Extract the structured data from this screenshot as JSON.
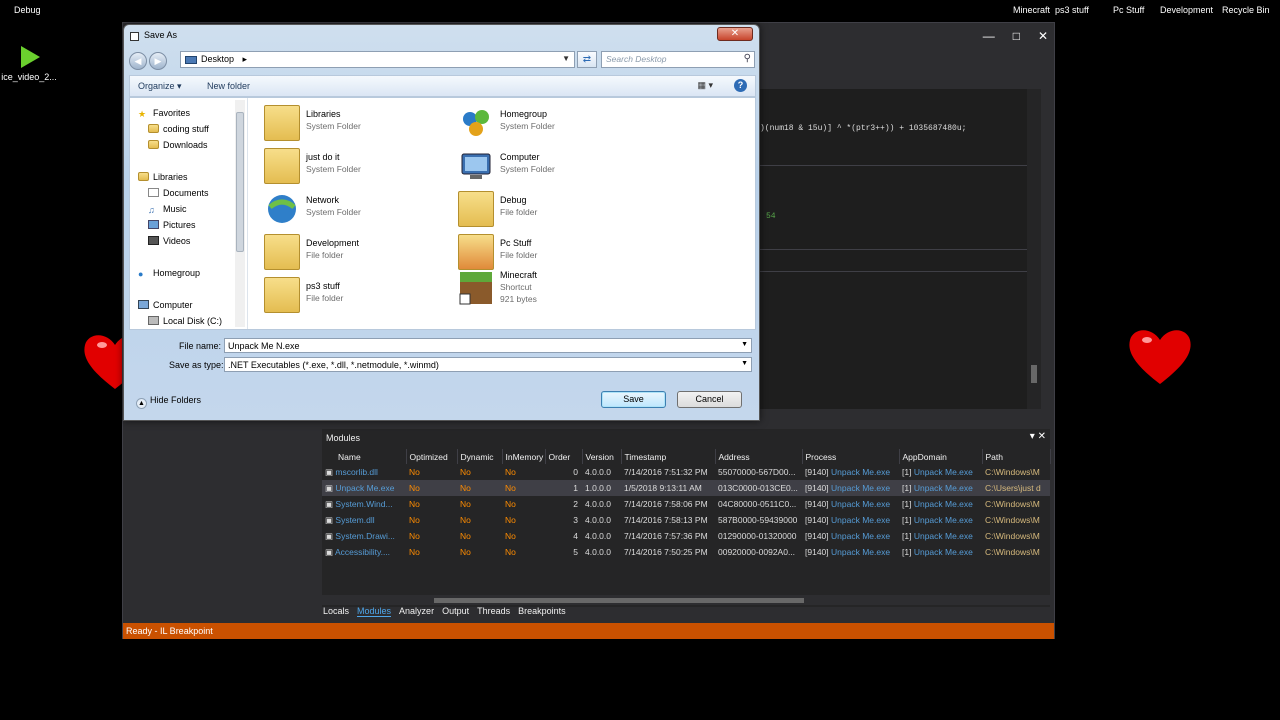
{
  "desktop": {
    "top_left_label": "Debug",
    "video_label": "ice_video_2...",
    "top_icons": [
      "Minecraft",
      "ps3 stuff",
      "Pc Stuff",
      "Development",
      "Recycle Bin"
    ]
  },
  "code": {
    "line1": ")(num18 & 15u)] ^ *(ptr3++)) + 1035687480u;",
    "line2": "54"
  },
  "modules": {
    "title": "Modules",
    "columns": [
      "Name",
      "Optimized",
      "Dynamic",
      "InMemory",
      "Order",
      "Version",
      "Timestamp",
      "Address",
      "Process",
      "AppDomain",
      "Path"
    ],
    "rows": [
      {
        "name": "mscorlib.dll",
        "optimized": "No",
        "dynamic": "No",
        "inmemory": "No",
        "order": "0",
        "version": "4.0.0.0",
        "timestamp": "7/14/2016 7:51:32 PM",
        "address": "55070000-567D00...",
        "process_id": "[9140]",
        "process_name": "Unpack Me.exe",
        "appdomain_id": "[1]",
        "appdomain_name": "Unpack Me.exe",
        "path": "C:\\Windows\\M"
      },
      {
        "name": "Unpack Me.exe",
        "optimized": "No",
        "dynamic": "No",
        "inmemory": "No",
        "order": "1",
        "version": "1.0.0.0",
        "timestamp": "1/5/2018 9:13:11 AM",
        "address": "013C0000-013CE0...",
        "process_id": "[9140]",
        "process_name": "Unpack Me.exe",
        "appdomain_id": "[1]",
        "appdomain_name": "Unpack Me.exe",
        "path": "C:\\Users\\just d"
      },
      {
        "name": "System.Wind...",
        "optimized": "No",
        "dynamic": "No",
        "inmemory": "No",
        "order": "2",
        "version": "4.0.0.0",
        "timestamp": "7/14/2016 7:58:06 PM",
        "address": "04C80000-0511C0...",
        "process_id": "[9140]",
        "process_name": "Unpack Me.exe",
        "appdomain_id": "[1]",
        "appdomain_name": "Unpack Me.exe",
        "path": "C:\\Windows\\M"
      },
      {
        "name": "System.dll",
        "optimized": "No",
        "dynamic": "No",
        "inmemory": "No",
        "order": "3",
        "version": "4.0.0.0",
        "timestamp": "7/14/2016 7:58:13 PM",
        "address": "587B0000-59439000",
        "process_id": "[9140]",
        "process_name": "Unpack Me.exe",
        "appdomain_id": "[1]",
        "appdomain_name": "Unpack Me.exe",
        "path": "C:\\Windows\\M"
      },
      {
        "name": "System.Drawi...",
        "optimized": "No",
        "dynamic": "No",
        "inmemory": "No",
        "order": "4",
        "version": "4.0.0.0",
        "timestamp": "7/14/2016 7:57:36 PM",
        "address": "01290000-01320000",
        "process_id": "[9140]",
        "process_name": "Unpack Me.exe",
        "appdomain_id": "[1]",
        "appdomain_name": "Unpack Me.exe",
        "path": "C:\\Windows\\M"
      },
      {
        "name": "Accessibility....",
        "optimized": "No",
        "dynamic": "No",
        "inmemory": "No",
        "order": "5",
        "version": "4.0.0.0",
        "timestamp": "7/14/2016 7:50:25 PM",
        "address": "00920000-0092A0...",
        "process_id": "[9140]",
        "process_name": "Unpack Me.exe",
        "appdomain_id": "[1]",
        "appdomain_name": "Unpack Me.exe",
        "path": "C:\\Windows\\M"
      }
    ],
    "selected_row": 1
  },
  "bottom_tabs": [
    "Locals",
    "Modules",
    "Analyzer",
    "Output",
    "Threads",
    "Breakpoints"
  ],
  "active_tab": "Modules",
  "status": "Ready - IL Breakpoint",
  "dialog": {
    "title": "Save As",
    "address": "Desktop",
    "search_placeholder": "Search Desktop",
    "organize": "Organize ▾",
    "new_folder": "New folder",
    "tree": {
      "favorites": "Favorites",
      "fav_items": [
        "coding stuff",
        "Downloads"
      ],
      "libraries": "Libraries",
      "lib_items": [
        "Documents",
        "Music",
        "Pictures",
        "Videos"
      ],
      "homegroup": "Homegroup",
      "computer": "Computer",
      "comp_items": [
        "Local Disk (C:)"
      ]
    },
    "items": [
      {
        "name": "Libraries",
        "type": "System Folder"
      },
      {
        "name": "Homegroup",
        "type": "System Folder"
      },
      {
        "name": "just do it",
        "type": "System Folder"
      },
      {
        "name": "Computer",
        "type": "System Folder"
      },
      {
        "name": "Network",
        "type": "System Folder"
      },
      {
        "name": "Debug",
        "type": "File folder"
      },
      {
        "name": "Development",
        "type": "File folder"
      },
      {
        "name": "Pc Stuff",
        "type": "File folder"
      },
      {
        "name": "ps3 stuff",
        "type": "File folder"
      },
      {
        "name": "Minecraft",
        "type": "Shortcut",
        "size": "921 bytes"
      }
    ],
    "file_name_label": "File name:",
    "file_name_value": "Unpack Me N.exe",
    "save_type_label": "Save as type:",
    "save_type_value": ".NET Executables (*.exe, *.dll, *.netmodule, *.winmd)",
    "hide_folders": "Hide Folders",
    "save": "Save",
    "cancel": "Cancel"
  }
}
